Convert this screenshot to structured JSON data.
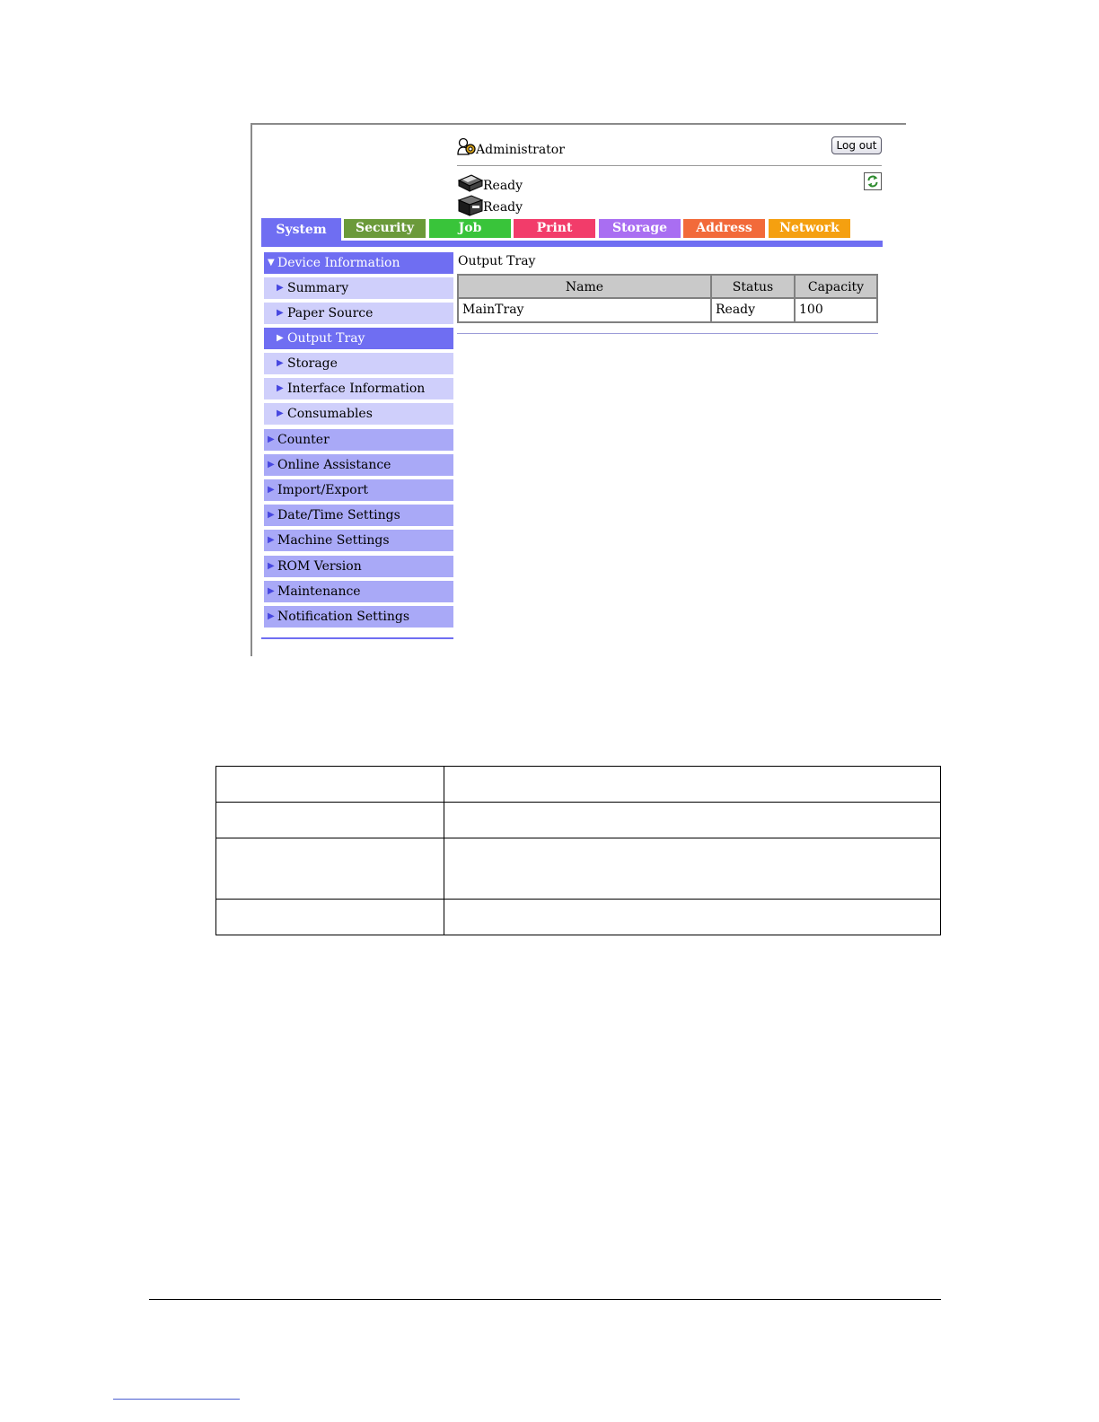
{
  "header": {
    "user_label": "Administrator",
    "logout_label": "Log out",
    "status": [
      {
        "label": "Ready",
        "icon": "printer-icon"
      },
      {
        "label": "Ready",
        "icon": "scanner-icon"
      }
    ],
    "refresh_icon": "refresh-icon"
  },
  "tabs": [
    {
      "label": "System",
      "color": "#6f6ef2",
      "active": true
    },
    {
      "label": "Security",
      "color": "#6b9a3a"
    },
    {
      "label": "Job",
      "color": "#39c43a"
    },
    {
      "label": "Print",
      "color": "#f23c6a"
    },
    {
      "label": "Storage",
      "color": "#a96ef2"
    },
    {
      "label": "Address",
      "color": "#f26a3a"
    },
    {
      "label": "Network",
      "color": "#f5a010"
    }
  ],
  "sidebar": {
    "items": [
      {
        "label": "Device Information",
        "level": 1,
        "expanded": true,
        "selected": true
      },
      {
        "label": "Summary",
        "level": 2
      },
      {
        "label": "Paper Source",
        "level": 2
      },
      {
        "label": "Output Tray",
        "level": 2,
        "selected": true
      },
      {
        "label": "Storage",
        "level": 2
      },
      {
        "label": "Interface Information",
        "level": 2
      },
      {
        "label": "Consumables",
        "level": 2
      },
      {
        "label": "Counter",
        "level": 1
      },
      {
        "label": "Online Assistance",
        "level": 1
      },
      {
        "label": "Import/Export",
        "level": 1
      },
      {
        "label": "Date/Time Settings",
        "level": 1
      },
      {
        "label": "Machine Settings",
        "level": 1
      },
      {
        "label": "ROM Version",
        "level": 1
      },
      {
        "label": "Maintenance",
        "level": 1
      },
      {
        "label": "Notification Settings",
        "level": 1
      }
    ]
  },
  "main": {
    "title": "Output Tray",
    "table": {
      "headers": [
        "Name",
        "Status",
        "Capacity"
      ],
      "rows": [
        [
          "MainTray",
          "Ready",
          "100"
        ]
      ]
    }
  }
}
